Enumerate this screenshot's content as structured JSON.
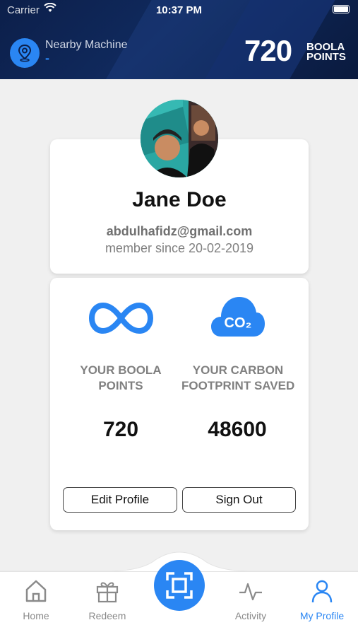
{
  "status_bar": {
    "carrier": "Carrier",
    "time": "10:37 PM"
  },
  "header": {
    "machine_label": "Nearby Machine",
    "machine_value": "-",
    "points_number": "720",
    "points_unit_line1": "BOOLA",
    "points_unit_line2": "POINTS"
  },
  "profile": {
    "name": "Jane Doe",
    "email": "abdulhafidz@gmail.com",
    "member_since": "member since 20-02-2019"
  },
  "stats": {
    "boola": {
      "label_line1": "YOUR BOOLA",
      "label_line2": "POINTS",
      "value": "720",
      "icon": "infinity-icon"
    },
    "carbon": {
      "label_line1": "YOUR CARBON",
      "label_line2": "FOOTPRINT SAVED",
      "value": "48600",
      "icon": "co2-cloud-icon",
      "icon_text": "CO₂"
    }
  },
  "buttons": {
    "edit_profile": "Edit Profile",
    "sign_out": "Sign Out"
  },
  "tabs": [
    {
      "label": "Home",
      "icon": "home-icon",
      "active": false
    },
    {
      "label": "Redeem",
      "icon": "gift-icon",
      "active": false
    },
    {
      "label": "Activity",
      "icon": "activity-icon",
      "active": false
    },
    {
      "label": "My Profile",
      "icon": "person-icon",
      "active": true
    }
  ],
  "colors": {
    "accent": "#2a86f3",
    "header_bg": "#0c1f4a",
    "text_muted": "#808080"
  }
}
